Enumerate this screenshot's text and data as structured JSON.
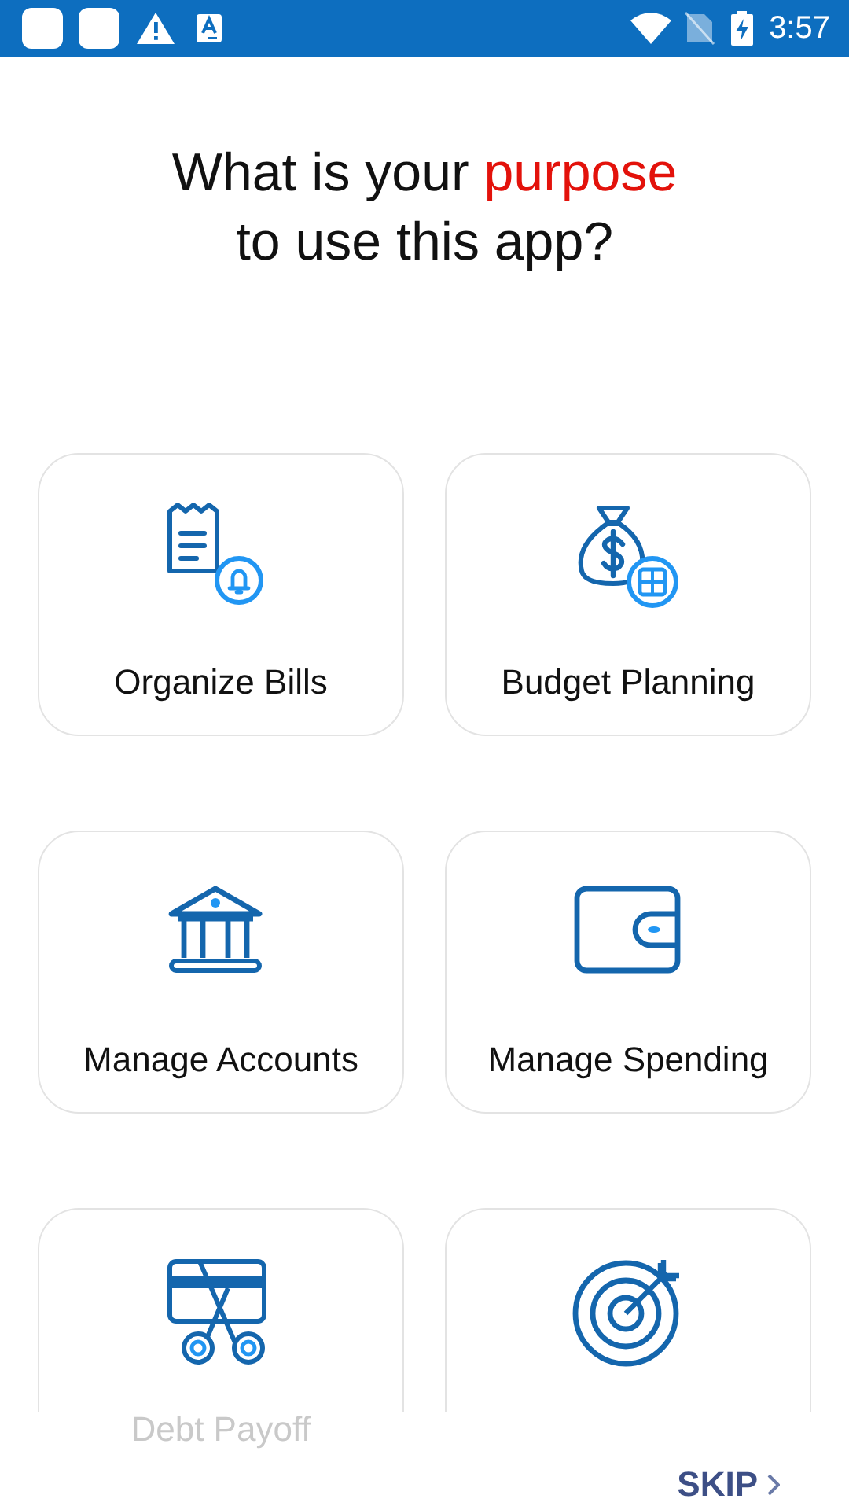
{
  "status_bar": {
    "time": "3:57"
  },
  "title": {
    "lead": "What is your ",
    "highlight": "purpose",
    "tail": "to use this app?"
  },
  "options": [
    {
      "kind": "bills",
      "label": "Organize Bills"
    },
    {
      "kind": "budget",
      "label": "Budget Planning"
    },
    {
      "kind": "bank",
      "label": "Manage Accounts"
    },
    {
      "kind": "wallet",
      "label": "Manage Spending"
    },
    {
      "kind": "debt",
      "label": "Debt Payoff"
    },
    {
      "kind": "goal"
    }
  ],
  "skip": {
    "label": "SKIP"
  }
}
